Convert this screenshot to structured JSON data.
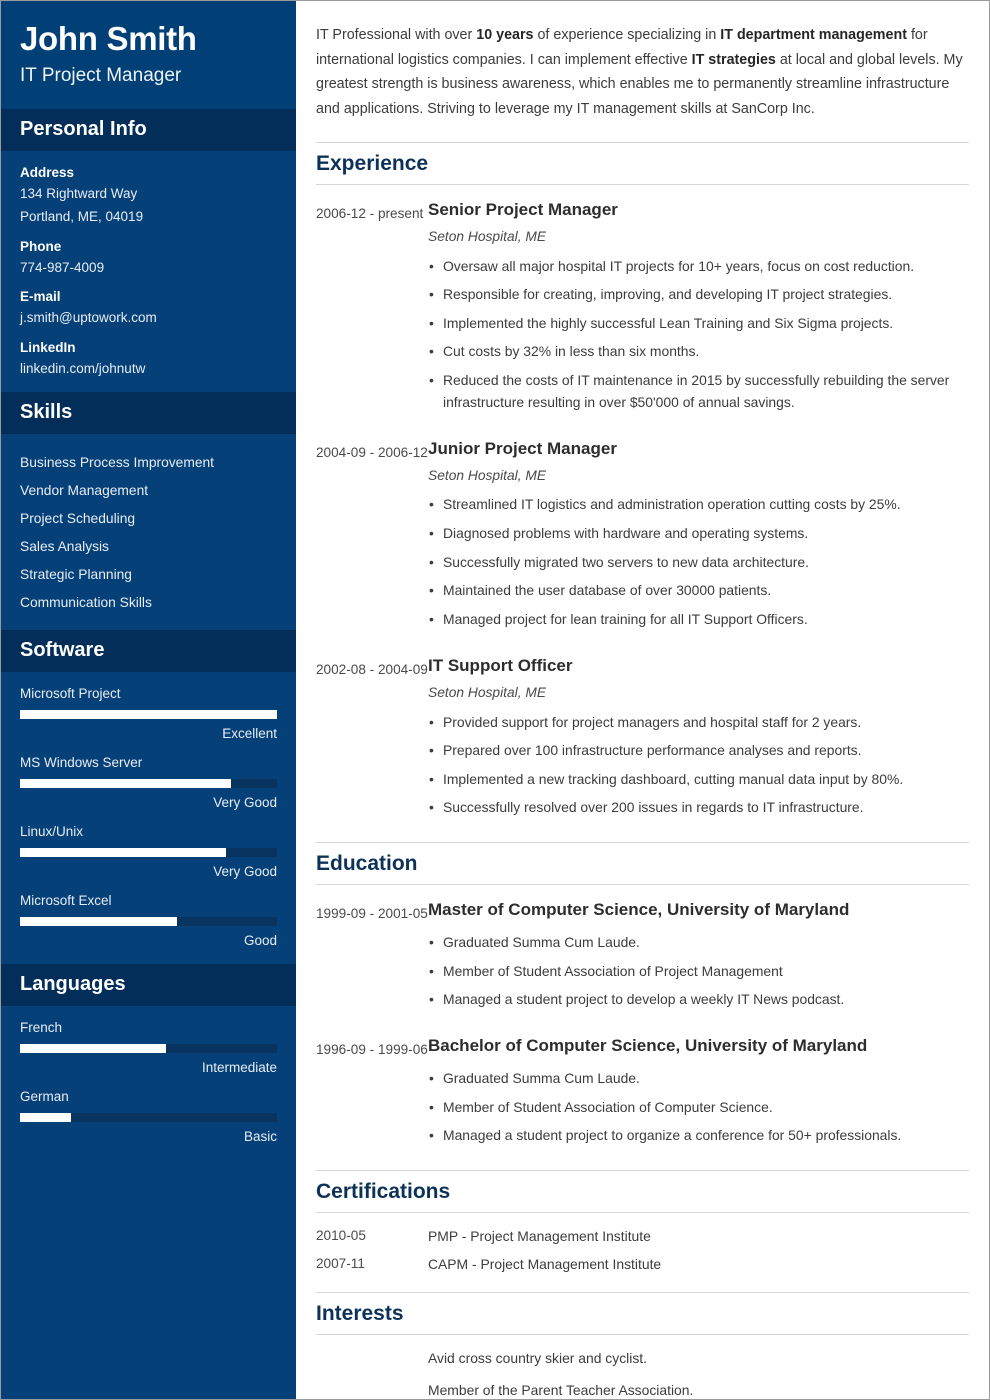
{
  "header": {
    "name": "John Smith",
    "job_title": "IT Project Manager"
  },
  "colors": {
    "sidebar_header_bg": "#014077",
    "sidebar_section_bg": "#032e59",
    "sidebar_body_bg": "#064079",
    "bar_track": "#0a3460",
    "bar_fill": "#ffffff",
    "heading": "#0d3258",
    "rule": "#d7d7d7"
  },
  "sidebar": {
    "personal_info": {
      "title": "Personal Info",
      "fields": [
        {
          "label": "Address",
          "values": [
            "134 Rightward Way",
            "Portland, ME, 04019"
          ]
        },
        {
          "label": "Phone",
          "values": [
            "774-987-4009"
          ]
        },
        {
          "label": "E-mail",
          "values": [
            "j.smith@uptowork.com"
          ]
        },
        {
          "label": "LinkedIn",
          "values": [
            "linkedin.com/johnutw"
          ]
        }
      ]
    },
    "skills": {
      "title": "Skills",
      "items": [
        "Business Process Improvement",
        "Vendor Management",
        "Project Scheduling",
        "Sales Analysis",
        "Strategic Planning",
        "Communication Skills"
      ]
    },
    "software": {
      "title": "Software",
      "items": [
        {
          "label": "Microsoft Project",
          "rating": "Excellent",
          "percent": 100
        },
        {
          "label": "MS Windows Server",
          "rating": "Very Good",
          "percent": 82
        },
        {
          "label": "Linux/Unix",
          "rating": "Very Good",
          "percent": 80
        },
        {
          "label": "Microsoft Excel",
          "rating": "Good",
          "percent": 61
        }
      ]
    },
    "languages": {
      "title": "Languages",
      "items": [
        {
          "label": "French",
          "rating": "Intermediate",
          "percent": 57
        },
        {
          "label": "German",
          "rating": "Basic",
          "percent": 20
        }
      ]
    }
  },
  "main": {
    "summary": {
      "parts": [
        {
          "text": "IT Professional with over ",
          "bold": false
        },
        {
          "text": "10 years",
          "bold": true
        },
        {
          "text": " of experience specializing in ",
          "bold": false
        },
        {
          "text": "IT department management",
          "bold": true
        },
        {
          "text": " for international logistics companies. I can implement effective ",
          "bold": false
        },
        {
          "text": "IT strategies",
          "bold": true
        },
        {
          "text": " at local and global levels. My greatest strength is business awareness, which enables me to permanently streamline infrastructure and applications. Striving to leverage my IT management skills at SanCorp Inc.",
          "bold": false
        }
      ]
    },
    "experience": {
      "title": "Experience",
      "entries": [
        {
          "date": "2006-12 - present",
          "title": "Senior Project Manager",
          "subtitle": "Seton Hospital, ME",
          "bullets": [
            "Oversaw all major hospital IT projects for 10+ years, focus on cost reduction.",
            "Responsible for creating, improving, and developing IT project strategies.",
            "Implemented the highly successful Lean Training and Six Sigma projects.",
            "Cut costs by 32% in less than six months.",
            "Reduced the costs of IT maintenance in 2015 by successfully rebuilding the server infrastructure resulting in over $50'000 of annual savings."
          ]
        },
        {
          "date": "2004-09 - 2006-12",
          "title": "Junior Project Manager",
          "subtitle": "Seton Hospital, ME",
          "bullets": [
            "Streamlined IT logistics and administration operation cutting costs by 25%.",
            "Diagnosed problems with hardware and operating systems.",
            "Successfully migrated two servers to new data architecture.",
            "Maintained the user database of over 30000 patients.",
            "Managed project for lean training for all IT Support Officers."
          ]
        },
        {
          "date": "2002-08 - 2004-09",
          "title": "IT Support Officer",
          "subtitle": "Seton Hospital, ME",
          "bullets": [
            "Provided support for project managers and hospital staff for 2 years.",
            "Prepared over 100 infrastructure performance analyses and reports.",
            "Implemented a new tracking dashboard, cutting manual data input by 80%.",
            "Successfully resolved over 200 issues in regards to IT infrastructure."
          ]
        }
      ]
    },
    "education": {
      "title": "Education",
      "entries": [
        {
          "date": "1999-09 - 2001-05",
          "title": "Master of Computer Science, University of Maryland",
          "bullets": [
            "Graduated Summa Cum Laude.",
            "Member of Student Association of Project Management",
            "Managed a student project to develop a weekly IT News podcast."
          ]
        },
        {
          "date": "1996-09 - 1999-06",
          "title": "Bachelor of Computer Science, University of Maryland",
          "bullets": [
            "Graduated Summa Cum Laude.",
            "Member of Student Association of Computer Science.",
            "Managed a student project to organize a conference for 50+ professionals."
          ]
        }
      ]
    },
    "certifications": {
      "title": "Certifications",
      "entries": [
        {
          "date": "2010-05",
          "text": "PMP - Project Management Institute"
        },
        {
          "date": "2007-11",
          "text": "CAPM - Project Management Institute"
        }
      ]
    },
    "interests": {
      "title": "Interests",
      "entries": [
        "Avid cross country skier and cyclist.",
        "Member of the Parent Teacher Association."
      ]
    }
  }
}
